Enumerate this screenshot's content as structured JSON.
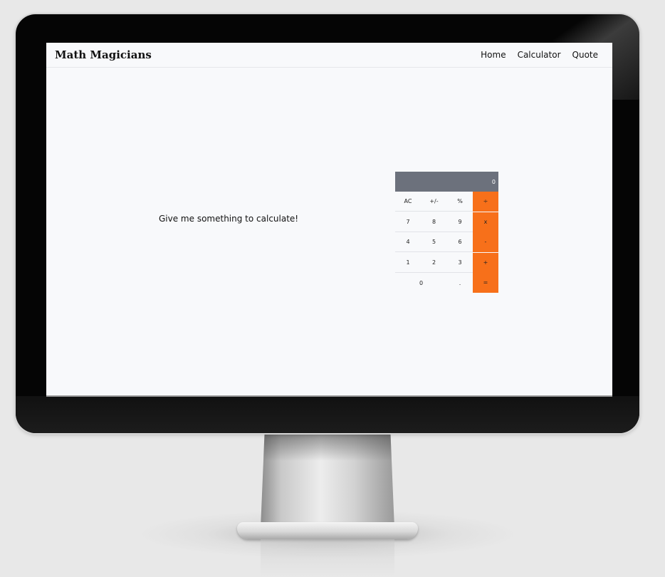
{
  "app": {
    "brand": "Math Magicians"
  },
  "nav": {
    "links": [
      "Home",
      "Calculator",
      "Quote"
    ]
  },
  "main": {
    "prompt": "Give me something to calculate!"
  },
  "calculator": {
    "display": "0",
    "buttons": {
      "ac": "AC",
      "plus_minus": "+/-",
      "percent": "%",
      "divide": "÷",
      "seven": "7",
      "eight": "8",
      "nine": "9",
      "multiply": "x",
      "four": "4",
      "five": "5",
      "six": "6",
      "minus": "-",
      "one": "1",
      "two": "2",
      "three": "3",
      "plus": "+",
      "zero": "0",
      "dot": ".",
      "equals": "="
    }
  },
  "colors": {
    "operator": "#f7701a",
    "display_bg": "#6c717c",
    "screen_bg": "#f8f9fb"
  }
}
